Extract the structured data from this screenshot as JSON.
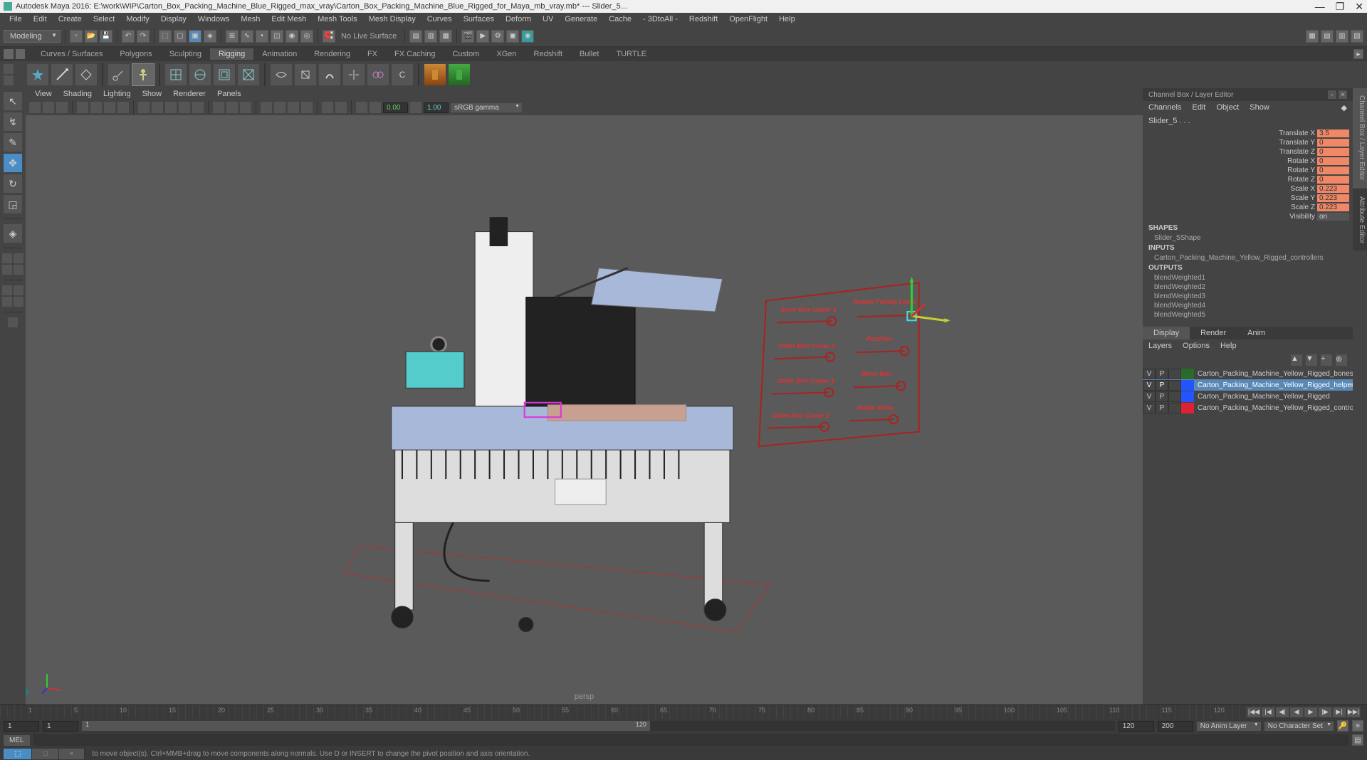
{
  "titlebar": {
    "app": "Autodesk Maya 2016: E:\\work\\WIP\\Carton_Box_Packing_Machine_Blue_Rigged_max_vray\\Carton_Box_Packing_Machine_Blue_Rigged_for_Maya_mb_vray.mb*   ---   Slider_5..."
  },
  "menubar": [
    "File",
    "Edit",
    "Create",
    "Select",
    "Modify",
    "Display",
    "Windows",
    "Mesh",
    "Edit Mesh",
    "Mesh Tools",
    "Mesh Display",
    "Curves",
    "Surfaces",
    "Deform",
    "UV",
    "Generate",
    "Cache",
    "- 3DtoAll -",
    "Redshift",
    "OpenFlight",
    "Help"
  ],
  "menuset": "Modeling",
  "live_surface": "No Live Surface",
  "shelf_tabs": [
    "Curves / Surfaces",
    "Polygons",
    "Sculpting",
    "Rigging",
    "Animation",
    "Rendering",
    "FX",
    "FX Caching",
    "Custom",
    "XGen",
    "Redshift",
    "Bullet",
    "TURTLE"
  ],
  "shelf_active": "Rigging",
  "viewport": {
    "menu": [
      "View",
      "Shading",
      "Lighting",
      "Show",
      "Renderer",
      "Panels"
    ],
    "near": "0.00",
    "far": "1.00",
    "colorspace": "sRGB gamma",
    "label": "persp"
  },
  "channel_panel_title": "Channel Box / Layer Editor",
  "channel_menu": [
    "Channels",
    "Edit",
    "Object",
    "Show"
  ],
  "object_name": "Slider_5 . . .",
  "channels": [
    {
      "label": "Translate X",
      "value": "3.5",
      "locked": true
    },
    {
      "label": "Translate Y",
      "value": "0",
      "locked": true
    },
    {
      "label": "Translate Z",
      "value": "0",
      "locked": true
    },
    {
      "label": "Rotate X",
      "value": "0",
      "locked": true
    },
    {
      "label": "Rotate Y",
      "value": "0",
      "locked": true
    },
    {
      "label": "Rotate Z",
      "value": "0",
      "locked": true
    },
    {
      "label": "Scale X",
      "value": "0.223",
      "locked": true
    },
    {
      "label": "Scale Y",
      "value": "0.223",
      "locked": true
    },
    {
      "label": "Scale Z",
      "value": "0.223",
      "locked": true
    },
    {
      "label": "Visibility",
      "value": "on",
      "locked": false
    }
  ],
  "shapes_header": "SHAPES",
  "shapes_item": "Slider_5Shape",
  "inputs_header": "INPUTS",
  "inputs_item": "Carton_Packing_Machine_Yellow_Rigged_controllers",
  "outputs_header": "OUTPUTS",
  "outputs_items": [
    "blendWeighted1",
    "blendWeighted2",
    "blendWeighted3",
    "blendWeighted4",
    "blendWeighted5"
  ],
  "display_tabs": [
    "Display",
    "Render",
    "Anim"
  ],
  "layers_menu": [
    "Layers",
    "Options",
    "Help"
  ],
  "layers": [
    {
      "v": "V",
      "p": "P",
      "color": "#2a6b2a",
      "name": "Carton_Packing_Machine_Yellow_Rigged_bones",
      "selected": false
    },
    {
      "v": "V",
      "p": "P",
      "color": "#2255ff",
      "name": "Carton_Packing_Machine_Yellow_Rigged_helpers",
      "selected": true
    },
    {
      "v": "V",
      "p": "P",
      "color": "#2255ff",
      "name": "Carton_Packing_Machine_Yellow_Rigged",
      "selected": false
    },
    {
      "v": "V",
      "p": "P",
      "color": "#dd2233",
      "name": "Carton_Packing_Machine_Yellow_Rigged_controllers",
      "selected": false
    }
  ],
  "side_tabs": [
    "Channel Box / Layer Editor",
    "Attribute Editor"
  ],
  "timeline_numbers": [
    "1",
    "5",
    "10",
    "15",
    "20",
    "25",
    "30",
    "35",
    "40",
    "45",
    "50",
    "55",
    "60",
    "65",
    "70",
    "75",
    "80",
    "85",
    "90",
    "95",
    "100",
    "105",
    "110",
    "115",
    "120"
  ],
  "range": {
    "start": "1",
    "end_inner": "1",
    "current": "1",
    "end_display": "120",
    "end": "120",
    "fps": "200"
  },
  "anim_layer": "No Anim Layer",
  "character_set": "No Character Set",
  "cmd_label": "MEL",
  "help_text": "to move object(s). Ctrl+MMB+drag to move components along normals. Use D or INSERT to change the pivot position and axis orientation.",
  "slider_labels": {
    "l1": "Inner Box Cover 1",
    "l2": "Inner Box Cover 2",
    "l3": "Outer Box Cover 1",
    "l4": "Outre Box Cover 2",
    "r1": "Rotate Folling Lever",
    "r2": "Position",
    "r3": "Move Box",
    "r4": "Roller Move"
  }
}
